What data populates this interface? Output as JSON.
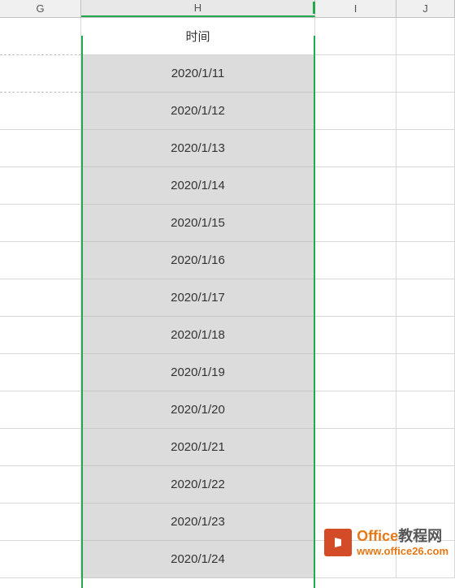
{
  "columns": {
    "g": "G",
    "h": "H",
    "i": "I",
    "j": "J"
  },
  "header_row": {
    "h": "时间"
  },
  "data_rows": [
    "2020/1/11",
    "2020/1/12",
    "2020/1/13",
    "2020/1/14",
    "2020/1/15",
    "2020/1/16",
    "2020/1/17",
    "2020/1/18",
    "2020/1/19",
    "2020/1/20",
    "2020/1/21",
    "2020/1/22",
    "2020/1/23",
    "2020/1/24"
  ],
  "watermark": {
    "title_part1": "Office",
    "title_part2": "教程网",
    "url": "www.office26.com"
  }
}
